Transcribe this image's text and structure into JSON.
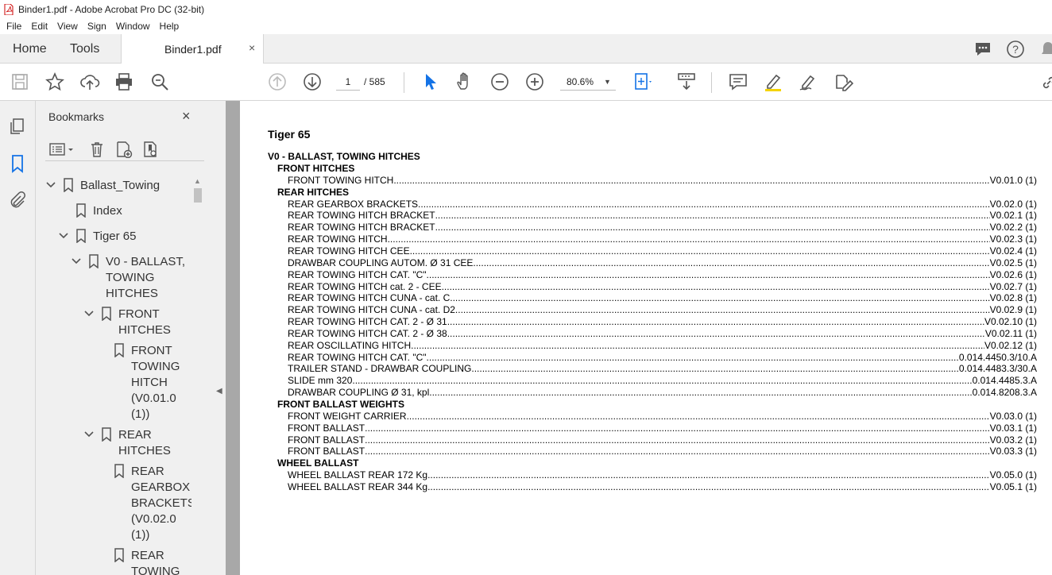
{
  "window": {
    "title": "Binder1.pdf - Adobe Acrobat Pro DC (32-bit)"
  },
  "menu": [
    "File",
    "Edit",
    "View",
    "Sign",
    "Window",
    "Help"
  ],
  "tabs": {
    "home": "Home",
    "tools": "Tools",
    "doc": "Binder1.pdf",
    "close": "×"
  },
  "toolbar": {
    "page": "1",
    "page_total": "/  585",
    "zoom": "80.6%"
  },
  "bookmarks": {
    "title": "Bookmarks",
    "close": "×",
    "items": [
      {
        "label": "Ballast_Towing"
      },
      {
        "label": "Index"
      },
      {
        "label": "Tiger 65"
      },
      {
        "label": "V0 - BALLAST, TOWING HITCHES"
      },
      {
        "label": "FRONT HITCHES"
      },
      {
        "label": "FRONT TOWING HITCH (V0.01.0 (1))"
      },
      {
        "label": "REAR HITCHES"
      },
      {
        "label": "REAR GEARBOX BRACKETS (V0.02.0 (1))"
      },
      {
        "label": "REAR TOWING"
      }
    ],
    "lines": {
      "b3": [
        "V0 - BALLAST,",
        "TOWING",
        "HITCHES"
      ],
      "b4": [
        "FRONT",
        "HITCHES"
      ],
      "b5": [
        "FRONT",
        "TOWING",
        "HITCH",
        "(V0.01.0",
        "(1))"
      ],
      "b6": [
        "REAR",
        "HITCHES"
      ],
      "b7": [
        "REAR",
        "GEARBOX",
        "BRACKETS",
        "(V0.02.0",
        "(1))"
      ],
      "b8": [
        "REAR",
        "TOWING"
      ]
    }
  },
  "document": {
    "title": "Tiger 65",
    "section": "V0 - BALLAST, TOWING HITCHES",
    "groups": [
      {
        "heading": "FRONT HITCHES",
        "entries": [
          {
            "name": "FRONT TOWING HITCH",
            "code": "V0.01.0 (1)"
          }
        ]
      },
      {
        "heading": "REAR HITCHES",
        "entries": [
          {
            "name": "REAR GEARBOX BRACKETS",
            "code": "V0.02.0 (1)"
          },
          {
            "name": "REAR TOWING HITCH BRACKET",
            "code": "V0.02.1 (1)"
          },
          {
            "name": "REAR TOWING HITCH BRACKET",
            "code": "V0.02.2 (1)"
          },
          {
            "name": "REAR TOWING HITCH",
            "code": "V0.02.3 (1)"
          },
          {
            "name": "REAR TOWING HITCH CEE",
            "code": "V0.02.4 (1)"
          },
          {
            "name": "DRAWBAR COUPLING AUTOM. Ø 31 CEE",
            "code": "V0.02.5 (1)"
          },
          {
            "name": "REAR TOWING HITCH CAT. \"C\"",
            "code": "V0.02.6 (1)"
          },
          {
            "name": "REAR TOWING HITCH cat. 2 - CEE",
            "code": "V0.02.7 (1)"
          },
          {
            "name": "REAR TOWING HITCH CUNA - cat. C",
            "code": "V0.02.8 (1)"
          },
          {
            "name": "REAR TOWING HITCH CUNA - cat. D2",
            "code": "V0.02.9 (1)"
          },
          {
            "name": "REAR TOWING HITCH CAT. 2 - Ø 31",
            "code": "V0.02.10 (1)"
          },
          {
            "name": "REAR TOWING HITCH CAT. 2 - Ø 38",
            "code": "V0.02.11 (1)"
          },
          {
            "name": "REAR OSCILLATING HITCH",
            "code": "V0.02.12 (1)"
          },
          {
            "name": "REAR TOWING HITCH CAT. \"C\"",
            "code": "0.014.4450.3/10.A"
          },
          {
            "name": "TRAILER STAND - DRAWBAR COUPLING",
            "code": "0.014.4483.3/30.A"
          },
          {
            "name": "SLIDE mm 320",
            "code": "0.014.4485.3.A"
          },
          {
            "name": "DRAWBAR COUPLING Ø 31, kpl",
            "code": "0.014.8208.3.A"
          }
        ]
      },
      {
        "heading": "FRONT BALLAST WEIGHTS",
        "entries": [
          {
            "name": "FRONT WEIGHT CARRIER",
            "code": "V0.03.0 (1)"
          },
          {
            "name": "FRONT BALLAST",
            "code": "V0.03.1 (1)"
          },
          {
            "name": "FRONT BALLAST",
            "code": "V0.03.2 (1)"
          },
          {
            "name": "FRONT BALLAST",
            "code": "V0.03.3 (1)"
          }
        ]
      },
      {
        "heading": "WHEEL BALLAST",
        "entries": [
          {
            "name": "WHEEL BALLAST REAR 172 Kg",
            "code": "V0.05.0 (1)"
          },
          {
            "name": "WHEEL BALLAST REAR 344 Kg",
            "code": "V0.05.1 (1)"
          }
        ]
      }
    ]
  }
}
